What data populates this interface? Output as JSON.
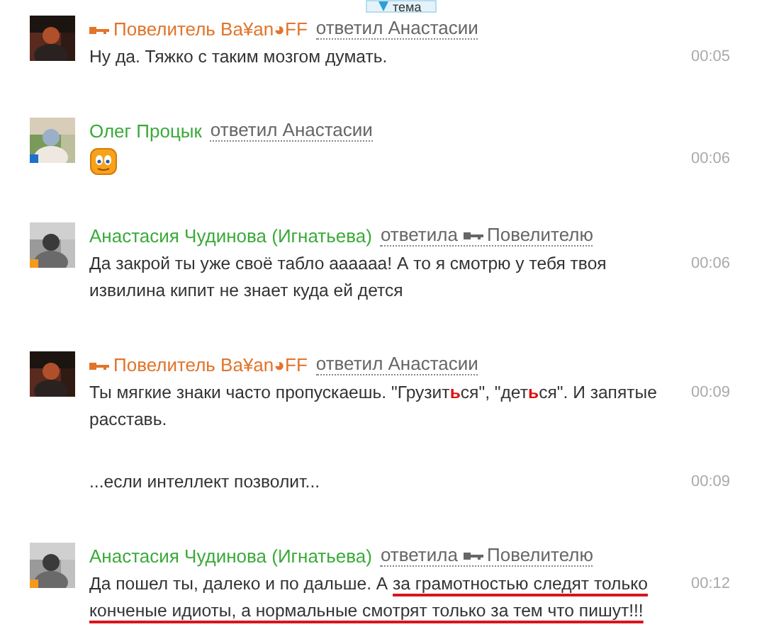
{
  "topic_tab": {
    "label": "тема"
  },
  "posts": [
    {
      "author": {
        "name": "Повелитель Ва¥an◕FF",
        "color": "#e2742a",
        "key": true
      },
      "reply": {
        "verb": "ответил",
        "key": false,
        "target": "Анастасии"
      },
      "messages": [
        {
          "time": "00:05",
          "parts": [
            {
              "text": "Ну да. Тяжко с таким мозгом думать.",
              "kind": "plain"
            }
          ]
        }
      ]
    },
    {
      "author": {
        "name": "Олег Процык",
        "color": "#3aaa3a",
        "key": false
      },
      "avatar": {
        "color": "#1e6fd0"
      },
      "reply": {
        "verb": "ответил",
        "key": false,
        "target": "Анастасии"
      },
      "messages": [
        {
          "time": "00:06",
          "kind": "emoji"
        }
      ]
    },
    {
      "author": {
        "name": "Анастасия Чудинова (Игнатьева)",
        "color": "#3aaa3a",
        "key": false
      },
      "avatar": {
        "color": "#f39a1e"
      },
      "reply": {
        "verb": "ответила",
        "key": true,
        "target": "Повелителю"
      },
      "messages": [
        {
          "time": "00:06",
          "parts": [
            {
              "text": "Да закрой ты уже своё табло аааааа! А то я смотрю у тебя твоя извилина кипит не знает куда ей дется",
              "kind": "plain"
            }
          ]
        }
      ]
    },
    {
      "author": {
        "name": "Повелитель Ва¥an◕FF",
        "color": "#e2742a",
        "key": true
      },
      "reply": {
        "verb": "ответил",
        "key": false,
        "target": "Анастасии"
      },
      "messages": [
        {
          "time": "00:09",
          "parts": [
            {
              "text": "Ты мягкие знаки часто пропускаешь. \"Грузит",
              "kind": "plain"
            },
            {
              "text": "ь",
              "kind": "red"
            },
            {
              "text": "ся\", \"дет",
              "kind": "plain"
            },
            {
              "text": "ь",
              "kind": "red"
            },
            {
              "text": "ся\". И запятые расставь.",
              "kind": "plain"
            }
          ]
        },
        {
          "time": "00:09",
          "parts": [
            {
              "text": "...если интеллект позволит...",
              "kind": "plain"
            }
          ]
        }
      ]
    },
    {
      "author": {
        "name": "Анастасия Чудинова (Игнатьева)",
        "color": "#3aaa3a",
        "key": false
      },
      "avatar": {
        "color": "#f39a1e"
      },
      "reply": {
        "verb": "ответила",
        "key": true,
        "target": "Повелителю"
      },
      "messages": [
        {
          "time": "00:12",
          "parts": [
            {
              "text": "Да пошел ты, далеко и по дальше. А ",
              "kind": "plain"
            },
            {
              "text": "за грамотностью следят только конченые идиоты, а нормальные смотрят только за тем что пишут!!!",
              "kind": "underlined"
            }
          ]
        }
      ]
    }
  ]
}
